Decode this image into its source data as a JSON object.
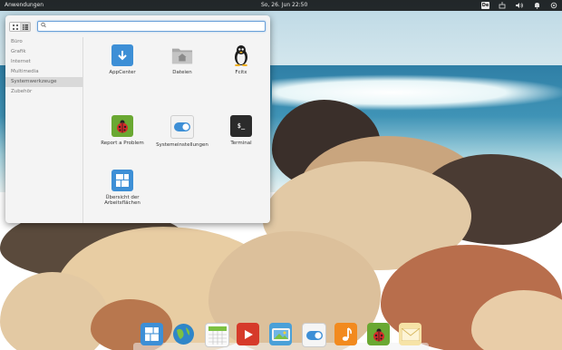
{
  "topbar": {
    "apps_label": "Anwendungen",
    "clock": "So, 26. Jun     22:50",
    "tray": [
      {
        "name": "keyboard-layout-indicator",
        "label": "De"
      },
      {
        "name": "network-icon",
        "icon": "network-icon"
      },
      {
        "name": "volume-icon",
        "icon": "volume-icon"
      },
      {
        "name": "notifications-icon",
        "icon": "bell-icon"
      },
      {
        "name": "session-icon",
        "icon": "power-icon"
      }
    ]
  },
  "launcher": {
    "search": {
      "value": "",
      "placeholder": ""
    },
    "categories": [
      "Büro",
      "Grafik",
      "Internet",
      "Multimedia",
      "Systemwerkzeuge",
      "Zubehör"
    ],
    "selected_category": "Systemwerkzeuge",
    "apps": [
      {
        "label": "AppCenter",
        "icon": "download-arrow-icon",
        "color": "#3d8fd6"
      },
      {
        "label": "Dateien",
        "icon": "home-folder-icon",
        "color": "#9a9a9a"
      },
      {
        "label": "Fcitx",
        "icon": "penguin-icon",
        "color": "#222222"
      },
      {
        "label": "Report a Problem",
        "icon": "ladybug-icon",
        "color": "#6aa832"
      },
      {
        "label": "Systemeinstellungen",
        "icon": "toggle-switch-icon",
        "color": "#3d8fd6"
      },
      {
        "label": "Terminal",
        "icon": "terminal-icon",
        "color": "#333333"
      },
      {
        "label": "Übersicht der Arbeitsflächen",
        "icon": "workspaces-icon",
        "color": "#3d8fd6"
      }
    ]
  },
  "dock": {
    "items": [
      {
        "name": "dock-multitasking-view",
        "icon": "workspaces-icon"
      },
      {
        "name": "dock-web-browser",
        "icon": "globe-icon"
      },
      {
        "name": "dock-calendar",
        "icon": "calendar-icon"
      },
      {
        "name": "dock-videos",
        "icon": "video-play-icon"
      },
      {
        "name": "dock-photos",
        "icon": "camera-photo-icon"
      },
      {
        "name": "dock-system-settings",
        "icon": "toggle-switch-icon"
      },
      {
        "name": "dock-music",
        "icon": "music-note-icon"
      },
      {
        "name": "dock-report-problem",
        "icon": "ladybug-icon"
      },
      {
        "name": "dock-mail",
        "icon": "envelope-icon"
      }
    ]
  }
}
